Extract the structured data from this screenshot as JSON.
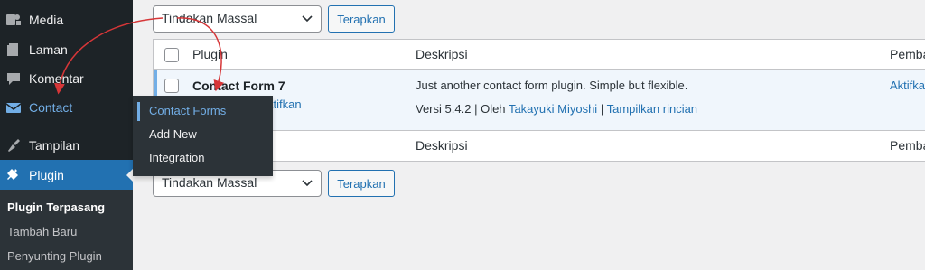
{
  "sidebar": {
    "items": [
      {
        "label": "Media",
        "icon": "media-icon"
      },
      {
        "label": "Laman",
        "icon": "pages-icon"
      },
      {
        "label": "Komentar",
        "icon": "comments-icon"
      },
      {
        "label": "Contact",
        "icon": "mail-icon"
      },
      {
        "label": "Tampilan",
        "icon": "appearance-icon"
      },
      {
        "label": "Plugin",
        "icon": "plugins-icon"
      }
    ],
    "submenu": [
      "Plugin Terpasang",
      "Tambah Baru",
      "Penyunting Plugin"
    ]
  },
  "flyout": {
    "items": [
      "Contact Forms",
      "Add New",
      "Integration"
    ]
  },
  "bulk_top": {
    "select_value": "Tindakan Massal",
    "apply_label": "Terapkan"
  },
  "bulk_bottom": {
    "select_value": "Tindakan Massal",
    "apply_label": "Terapkan"
  },
  "table": {
    "col_plugin": "Plugin",
    "col_description": "Deskripsi",
    "col_updates": "Pemba",
    "row": {
      "name": "Contact Form 7",
      "action_partial": "ktifkan",
      "description": "Just another contact form plugin. Simple but flexible.",
      "version": "Versi 5.4.2",
      "separator1": "|",
      "by": "Oleh",
      "author": "Takayuki Miyoshi",
      "separator2": "|",
      "details": "Tampilkan rincian",
      "update_action": "Aktifka"
    },
    "foot_description": "Deskripsi",
    "foot_updates": "Pemba"
  },
  "colors": {
    "sidebar_bg": "#1d2327",
    "accent": "#2271b1",
    "highlight": "#72aee6",
    "arrow": "#d63638"
  }
}
